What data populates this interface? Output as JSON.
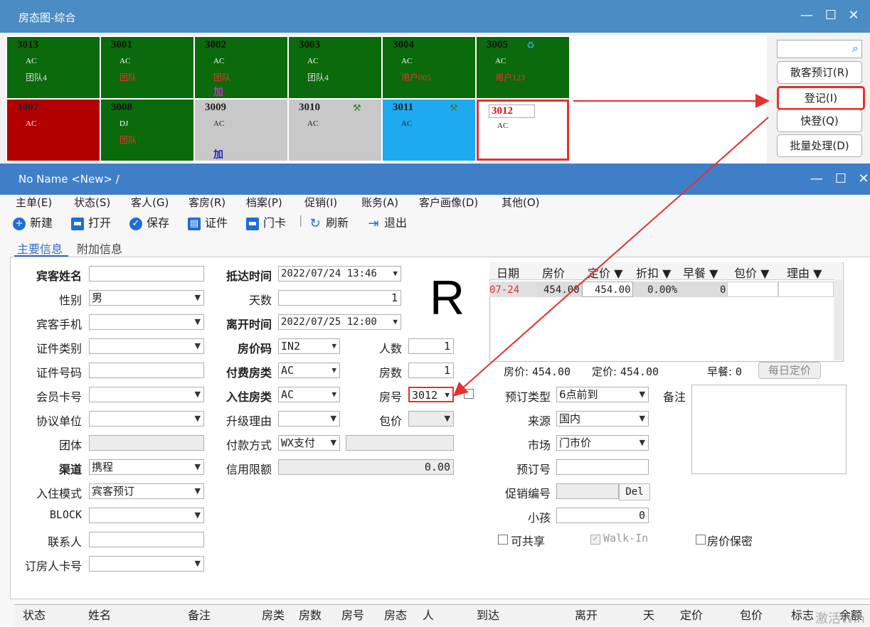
{
  "room_window": {
    "title": "房态图-综合",
    "rooms": [
      {
        "num": "3013",
        "type": "AC",
        "name": "团队4",
        "add": ""
      },
      {
        "num": "3001",
        "type": "AC",
        "name": "团队",
        "add": ""
      },
      {
        "num": "3002",
        "type": "AC",
        "name": "团队",
        "add": "加"
      },
      {
        "num": "3003",
        "type": "AC",
        "name": "团队4",
        "add": ""
      },
      {
        "num": "3004",
        "type": "AC",
        "name": "用户005",
        "add": ""
      },
      {
        "num": "3005",
        "type": "AC",
        "name": "用户123",
        "add": ""
      },
      {
        "num": "3007",
        "type": "AC",
        "name": "",
        "add": ""
      },
      {
        "num": "3008",
        "type": "DJ",
        "name": "团队",
        "add": ""
      },
      {
        "num": "3009",
        "type": "AC",
        "name": "",
        "add": "加"
      },
      {
        "num": "3010",
        "type": "AC",
        "name": "",
        "add": ""
      },
      {
        "num": "3011",
        "type": "AC",
        "name": "",
        "add": ""
      },
      {
        "num": "3012",
        "type": "AC",
        "name": "",
        "add": ""
      }
    ],
    "search_placeholder": "",
    "buttons": [
      "散客预订(R)",
      "登记(I)",
      "快登(Q)",
      "批量处理(D)"
    ]
  },
  "form_window": {
    "title": "No Name <New> /",
    "menu": [
      "主单(E)",
      "状态(S)",
      "客人(G)",
      "客房(R)",
      "档案(P)",
      "促销(I)",
      "账务(A)",
      "客户画像(D)",
      "其他(O)"
    ],
    "toolbar": [
      "新建",
      "打开",
      "保存",
      "证件",
      "门卡",
      "刷新",
      "退出"
    ],
    "tabs": [
      "主要信息",
      "附加信息"
    ],
    "big_letter": "R",
    "left_labels": [
      "宾客姓名",
      "性别",
      "宾客手机",
      "证件类别",
      "证件号码",
      "会员卡号",
      "协议单位",
      "团体",
      "渠道",
      "入住模式",
      "BLOCK",
      "联系人",
      "订房人卡号"
    ],
    "left_values": [
      "",
      "男",
      "",
      "",
      "",
      "",
      "",
      "",
      "携程",
      "宾客预订",
      "",
      "",
      ""
    ],
    "mid_labels": [
      "抵达时间",
      "天数",
      "离开时间",
      "房价码",
      "付费房类",
      "入住房类",
      "升级理由",
      "付款方式",
      "信用限额"
    ],
    "mid_values": [
      "2022/07/24 13:46",
      "1",
      "2022/07/25 12:00",
      "IN2",
      "AC",
      "AC",
      "",
      "WX支付",
      "0.00"
    ],
    "right_labels": [
      "人数",
      "房数",
      "房号",
      "包价"
    ],
    "right_values": [
      "1",
      "1",
      "3012",
      ""
    ],
    "rate_table": {
      "headers": [
        "日期",
        "房价",
        "定价 ▼",
        "折扣 ▼",
        "早餐 ▼",
        "包价 ▼",
        "理由 ▼"
      ],
      "row": [
        "07-24",
        "454.00",
        "454.00",
        "0.00%",
        "0",
        "",
        ""
      ]
    },
    "summary": {
      "price_label": "房价:",
      "price": "454.00",
      "set_label": "定价:",
      "set": "454.00",
      "bf_label": "早餐:",
      "bf": "0",
      "daily_button": "每日定价"
    },
    "booking_labels": [
      "预订类型",
      "来源",
      "市场",
      "预订号",
      "促销编号",
      "小孩"
    ],
    "booking_values": [
      "6点前到",
      "国内",
      "门市价",
      "",
      "",
      "0"
    ],
    "del_button": "Del",
    "remark_label": "备注",
    "checks": [
      "可共享",
      "Walk-In",
      "房价保密"
    ],
    "bottom_headers": [
      "状态",
      "姓名",
      "备注",
      "房类",
      "房数",
      "房号",
      "房态",
      "人",
      "到达",
      "离开",
      "天",
      "定价",
      "包价",
      "标志",
      "余额"
    ],
    "watermark": "激活Win"
  }
}
